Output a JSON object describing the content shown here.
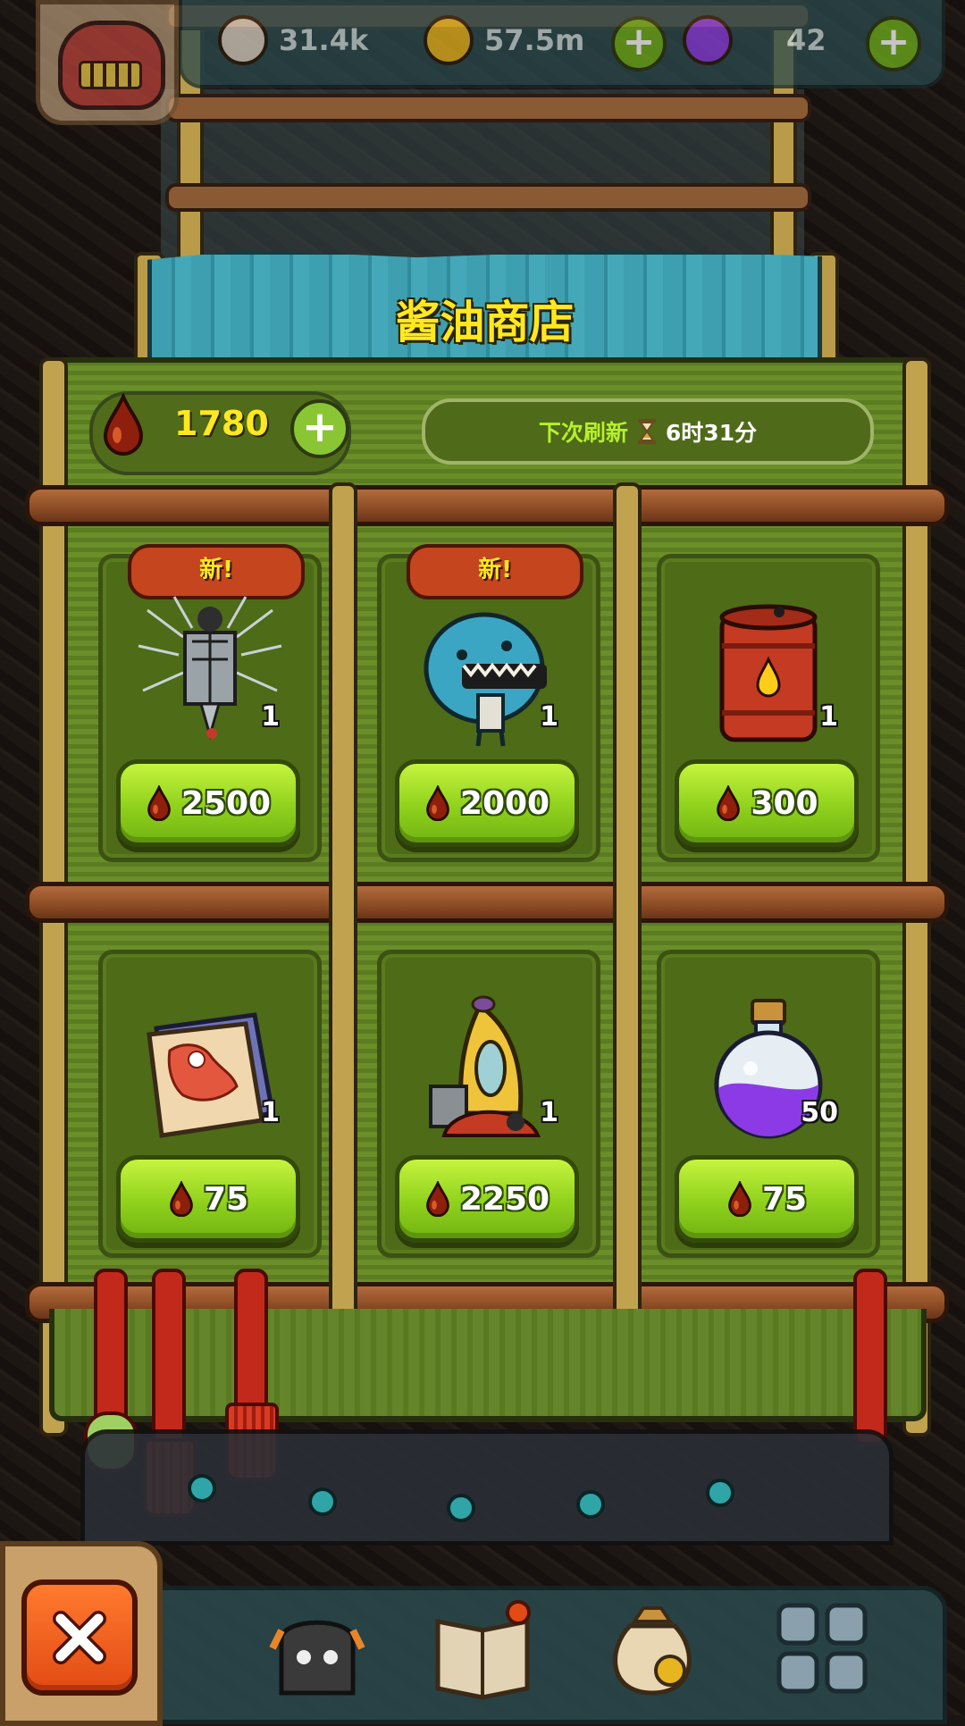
{
  "topbar": {
    "eyes_value": "31.4k",
    "coins_value": "57.5m",
    "potions_value": "42"
  },
  "shop": {
    "title": "酱油商店",
    "currency_value": "1780",
    "refresh_label": "下次刷新",
    "refresh_time": "6时31分"
  },
  "items": [
    {
      "badge": "新!",
      "name": "sketch-creature-item",
      "quantity": "1",
      "price": "2500"
    },
    {
      "badge": "新!",
      "name": "blue-fish-monster-item",
      "quantity": "1",
      "price": "2000"
    },
    {
      "badge": "",
      "name": "red-oil-barrel-item",
      "quantity": "1",
      "price": "300"
    },
    {
      "badge": "",
      "name": "treasure-map-scroll-item",
      "quantity": "1",
      "price": "75"
    },
    {
      "badge": "",
      "name": "banana-machine-item",
      "quantity": "1",
      "price": "2250"
    },
    {
      "badge": "",
      "name": "purple-potion-item",
      "quantity": "50",
      "price": "75"
    }
  ],
  "colors": {
    "board_green": "#678a26",
    "title_yellow": "#ffe81f",
    "price_button_green": "#8fd11c",
    "new_badge_red": "#c4451e",
    "close_orange": "#e24b14",
    "soy_drop": "#8e1f0c"
  }
}
